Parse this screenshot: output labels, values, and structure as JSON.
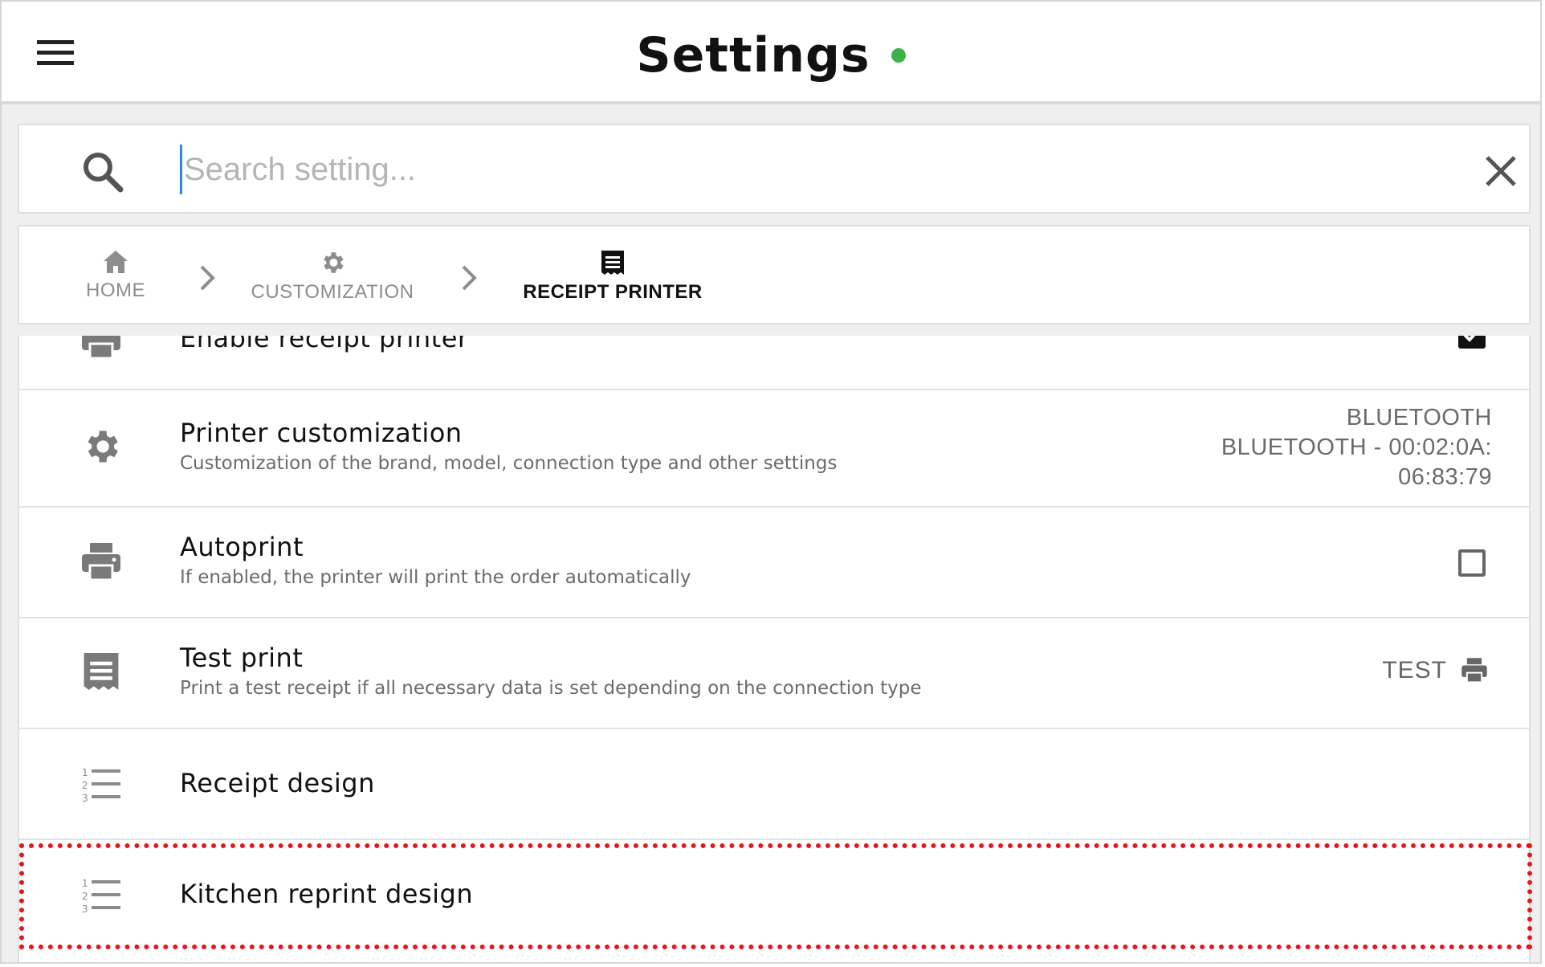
{
  "header": {
    "title": "Settings",
    "status_color": "#3db24b"
  },
  "search": {
    "placeholder": "Search setting...",
    "value": ""
  },
  "breadcrumb": {
    "items": [
      {
        "label": "HOME",
        "icon": "home-icon"
      },
      {
        "label": "CUSTOMIZATION",
        "icon": "gear-icon"
      },
      {
        "label": "RECEIPT PRINTER",
        "icon": "receipt-icon"
      }
    ]
  },
  "settings": {
    "items": [
      {
        "title": "Enable receipt printer",
        "icon": "printer-icon",
        "checked": true
      },
      {
        "title": "Printer customization",
        "subtitle": "Customization of the brand, model, connection type and other settings",
        "icon": "gear-icon",
        "value_lines": [
          "BLUETOOTH",
          "BLUETOOTH - 00:02:0A:",
          "06:83:79"
        ]
      },
      {
        "title": "Autoprint",
        "subtitle": "If enabled, the printer will print the order automatically",
        "icon": "printer-icon",
        "checked": false
      },
      {
        "title": "Test print",
        "subtitle": "Print a test receipt if all necessary data is set depending on the connection type",
        "icon": "receipt-icon",
        "action_label": "TEST"
      },
      {
        "title": "Receipt design",
        "icon": "numbered-list-icon"
      },
      {
        "title": "Kitchen reprint design",
        "icon": "numbered-list-icon"
      }
    ]
  },
  "colors": {
    "highlight": "#e8151b",
    "cursor": "#2a8ce8"
  }
}
